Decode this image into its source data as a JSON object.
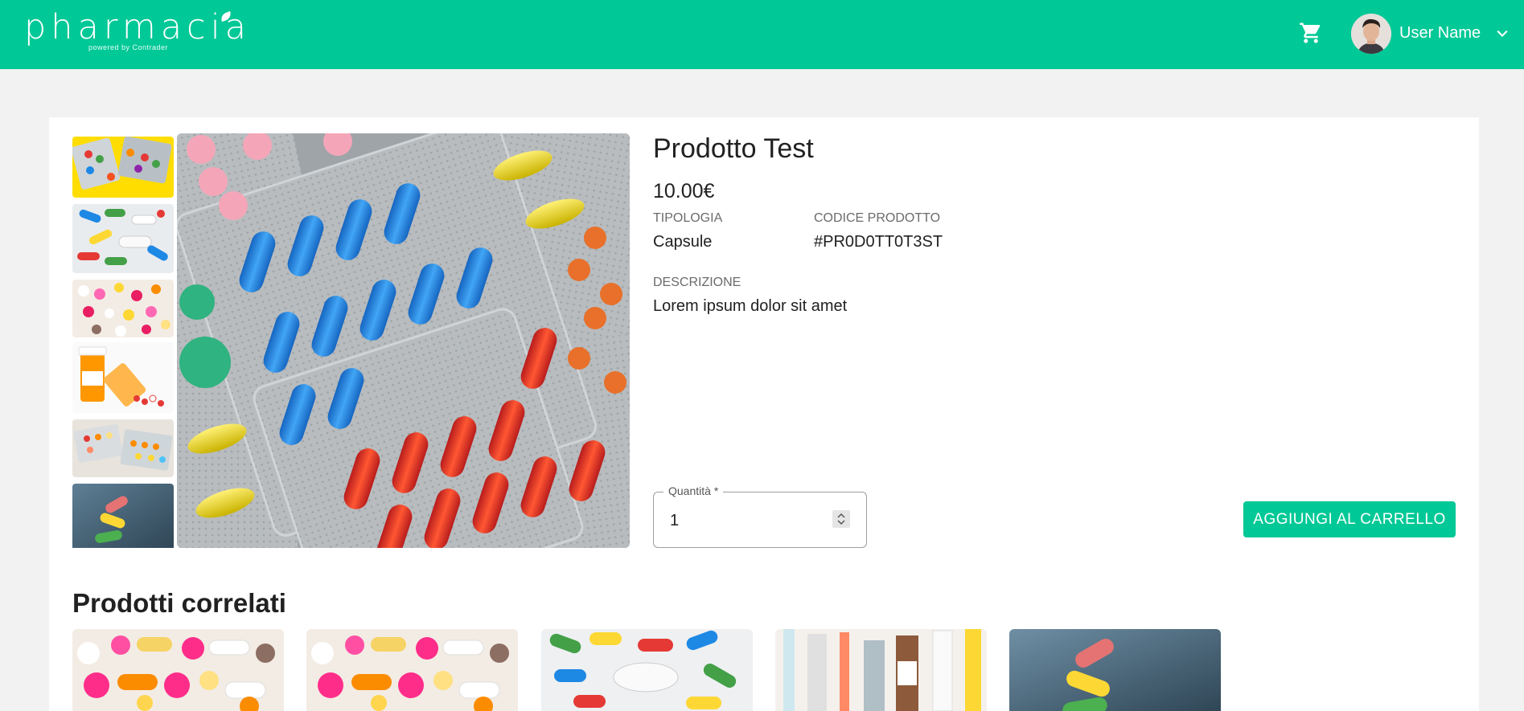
{
  "header": {
    "logo_text": "pharmacia",
    "logo_sub": "powered by Contrader",
    "user_name": "User Name",
    "bg_color": "#00c896"
  },
  "product": {
    "title": "Prodotto Test",
    "price": "10.00€",
    "type_label": "TIPOLOGIA",
    "type_value": "Capsule",
    "code_label": "CODICE PRODOTTO",
    "code_value": "#PR0D0TT0T3ST",
    "desc_label": "DESCRIZIONE",
    "desc_value": "Lorem ipsum dolor sit amet"
  },
  "quantity": {
    "label": "Quantità *",
    "value": "1"
  },
  "add_to_cart_label": "AGGIUNGI AL CARRELLO",
  "related": {
    "title": "Prodotti correlati"
  },
  "icons": {
    "cart": "cart-icon",
    "dropdown": "chevron-down-icon",
    "spinner": "spinner-icon"
  }
}
